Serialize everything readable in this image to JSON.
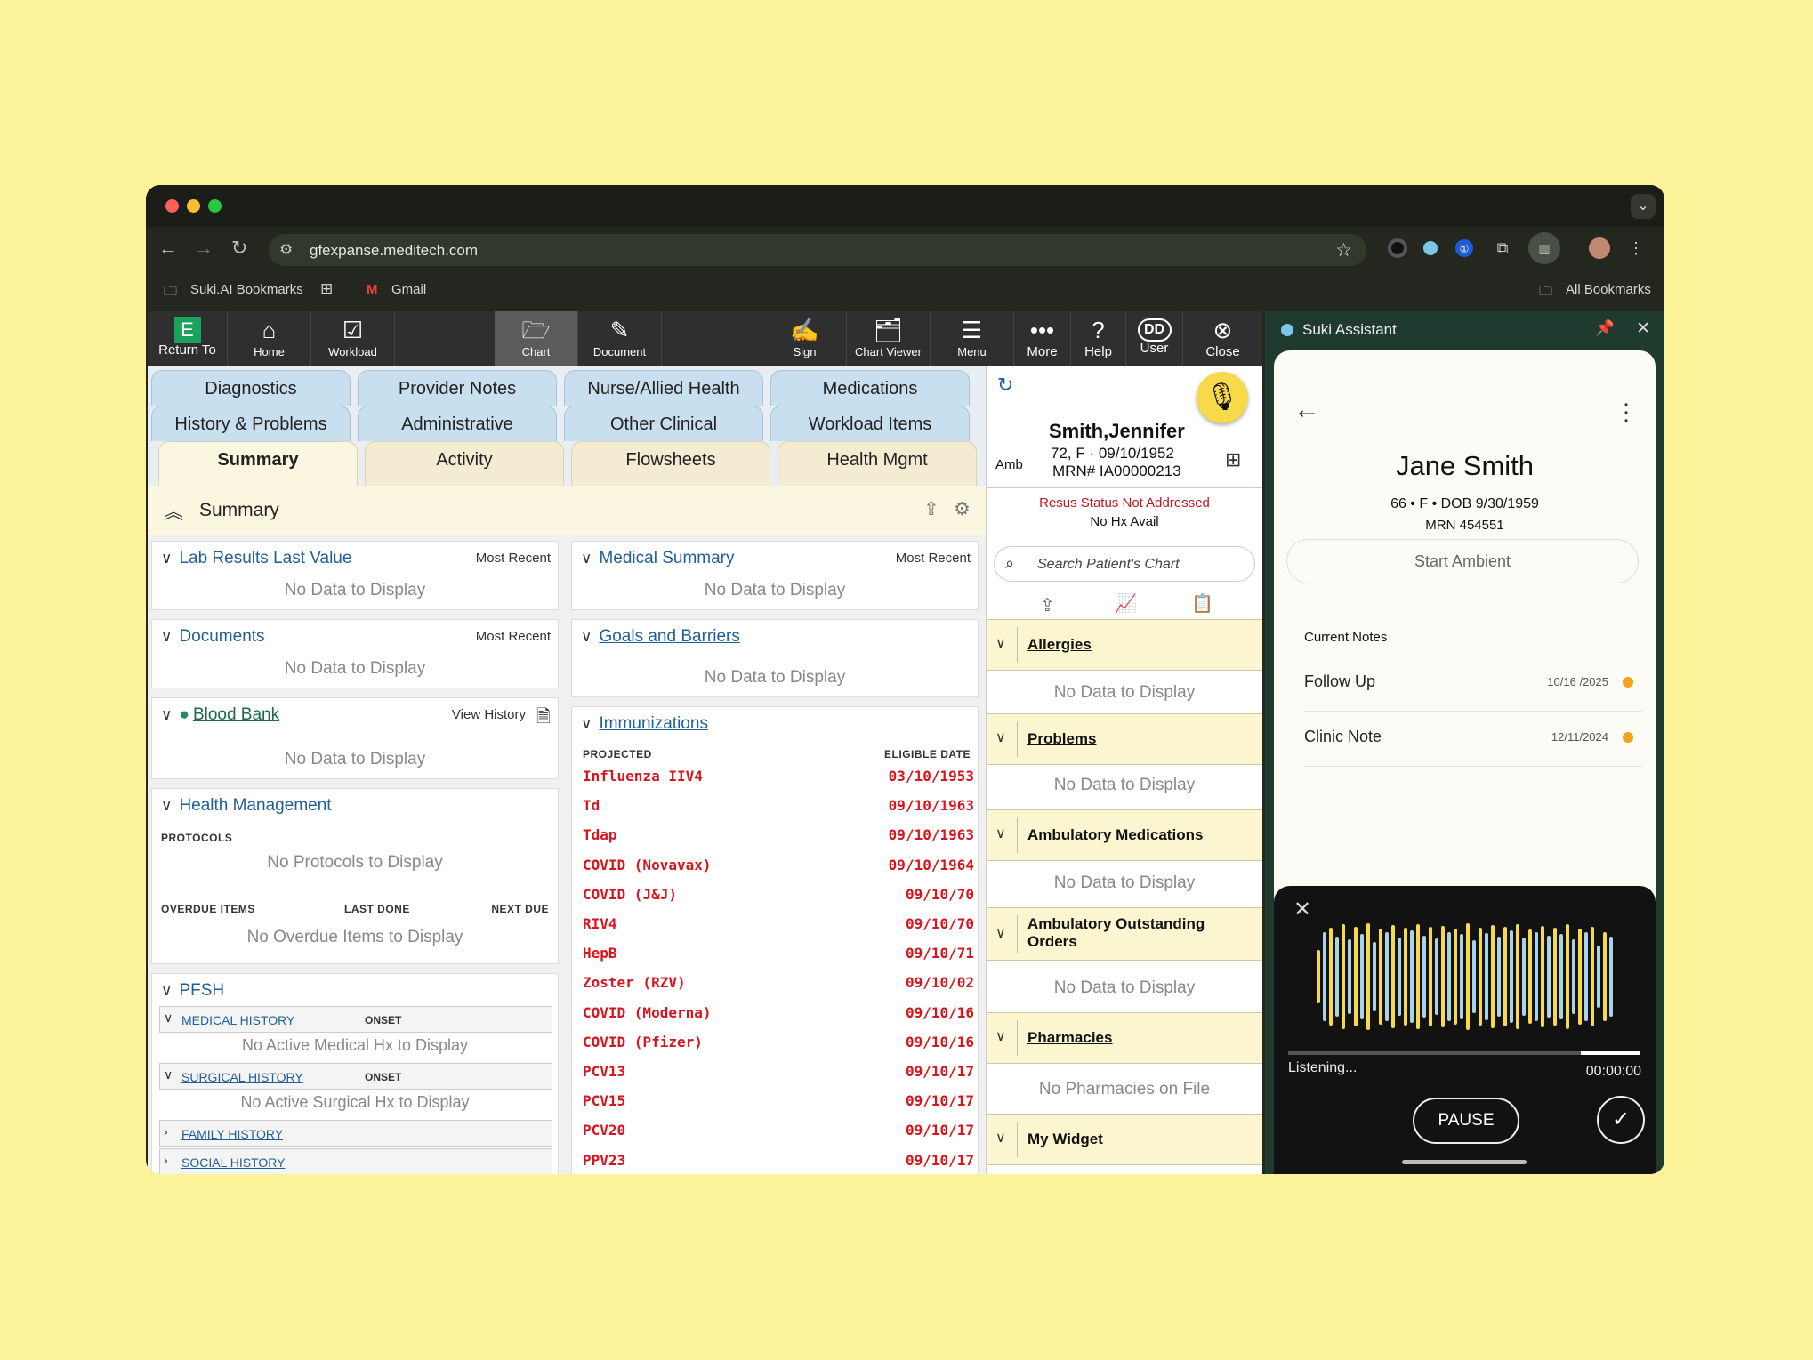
{
  "browser": {
    "url": "gfexpanse.meditech.com",
    "bookmarks": [
      {
        "label": "Suki.AI Bookmarks"
      },
      {
        "label": "Gmail"
      }
    ],
    "all_bookmarks": "All Bookmarks"
  },
  "toolbar": {
    "return_to": "Return To",
    "home": "Home",
    "workload": "Workload",
    "chart": "Chart",
    "document": "Document",
    "sign": "Sign",
    "chart_viewer": "Chart Viewer",
    "menu": "Menu",
    "more": "More",
    "help": "Help",
    "user_initials": "DD",
    "user": "User",
    "close": "Close"
  },
  "tabs": {
    "row1": [
      "Diagnostics",
      "Provider Notes",
      "Nurse/Allied Health",
      "Medications"
    ],
    "row2": [
      "History & Problems",
      "Administrative",
      "Other Clinical",
      "Workload Items"
    ],
    "row3": [
      "Summary",
      "Activity",
      "Flowsheets",
      "Health Mgmt"
    ]
  },
  "summary": {
    "title": "Summary",
    "lab_results": {
      "title": "Lab Results Last Value",
      "right": "Most Recent",
      "empty": "No Data to Display"
    },
    "documents": {
      "title": "Documents",
      "right": "Most Recent",
      "empty": "No Data to Display"
    },
    "blood_bank": {
      "title": "Blood Bank",
      "right": "View History",
      "empty": "No Data to Display"
    },
    "health_mgmt": {
      "title": "Health Management",
      "protocols": "PROTOCOLS",
      "protocols_empty": "No Protocols to Display",
      "overdue": "OVERDUE ITEMS",
      "last_done": "LAST DONE",
      "next_due": "NEXT DUE",
      "overdue_empty": "No Overdue Items to Display"
    },
    "pfsh": {
      "title": "PFSH",
      "medical": "MEDICAL HISTORY",
      "onset": "ONSET",
      "medical_empty": "No Active Medical Hx to Display",
      "surgical": "SURGICAL HISTORY",
      "surgical_empty": "No Active Surgical Hx to Display",
      "family": "FAMILY HISTORY",
      "social": "SOCIAL HISTORY"
    },
    "medical_summary": {
      "title": "Medical Summary",
      "right": "Most Recent",
      "empty": "No Data to Display"
    },
    "goals": {
      "title": "Goals and Barriers",
      "empty": "No Data to Display"
    },
    "immunizations": {
      "title": "Immunizations",
      "col_projected": "PROJECTED",
      "col_date": "ELIGIBLE DATE",
      "rows": [
        {
          "name": "Influenza IIV4",
          "date": "03/10/1953"
        },
        {
          "name": "Td",
          "date": "09/10/1963"
        },
        {
          "name": "Tdap",
          "date": "09/10/1963"
        },
        {
          "name": "COVID (Novavax)",
          "date": "09/10/1964"
        },
        {
          "name": "COVID (J&J)",
          "date": "09/10/70"
        },
        {
          "name": "RIV4",
          "date": "09/10/70"
        },
        {
          "name": "HepB",
          "date": "09/10/71"
        },
        {
          "name": "Zoster (RZV)",
          "date": "09/10/02"
        },
        {
          "name": "COVID (Moderna)",
          "date": "09/10/16"
        },
        {
          "name": "COVID (Pfizer)",
          "date": "09/10/16"
        },
        {
          "name": "PCV13",
          "date": "09/10/17"
        },
        {
          "name": "PCV15",
          "date": "09/10/17"
        },
        {
          "name": "PCV20",
          "date": "09/10/17"
        },
        {
          "name": "PPV23",
          "date": "09/10/17"
        }
      ]
    }
  },
  "patient": {
    "name": "Smith,Jennifer",
    "amb": "Amb",
    "age_sex_dob": "72, F  ·  09/10/1952",
    "mrn": "MRN#  IA00000213",
    "resus": "Resus Status Not Addressed",
    "nohx": "No Hx Avail",
    "search_placeholder": "Search Patient's Chart",
    "sections": [
      {
        "label": "Allergies",
        "empty": "No Data to Display"
      },
      {
        "label": "Problems",
        "empty": "No Data to Display"
      },
      {
        "label": "Ambulatory Medications",
        "empty": "No Data to Display"
      },
      {
        "label": "Ambulatory Outstanding Orders",
        "empty": "No Data to Display"
      },
      {
        "label": "Pharmacies",
        "empty": "No Pharmacies on File"
      },
      {
        "label": "My Widget"
      }
    ]
  },
  "suki": {
    "title": "Suki Assistant",
    "patient_name": "Jane Smith",
    "patient_info": "66 • F • DOB 9/30/1959",
    "mrn": "MRN 454551",
    "start_ambient": "Start Ambient",
    "current_notes": "Current Notes",
    "notes": [
      {
        "name": "Follow Up",
        "date": "10/16 /2025"
      },
      {
        "name": "Clinic Note",
        "date": "12/11/2024"
      }
    ],
    "status": "Listening...",
    "timer": "00:00:00",
    "pause": "PAUSE",
    "progress": 0.17,
    "colors": {
      "accent": "#f2a21b",
      "wave_yellow": "#f7d94a",
      "wave_blue": "#a9d3ea"
    }
  }
}
